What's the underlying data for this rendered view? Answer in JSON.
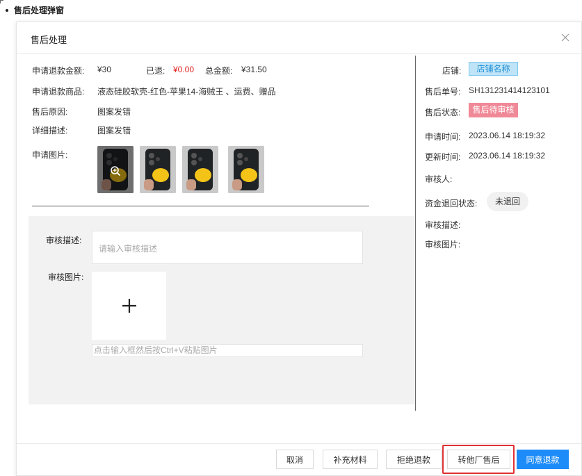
{
  "page": {
    "heading": "售后处理弹窗"
  },
  "dialog": {
    "title": "售后处理",
    "refund_amount_label": "申请退款金额:",
    "refund_amount": "¥30",
    "refunded_label": "已退:",
    "refunded_value": "¥0.00",
    "total_label": "总金额:",
    "total_value": "¥31.50",
    "goods_label": "申请退款商品:",
    "goods_value": "液态硅胶软壳-红色-苹果14-海贼王 、运费、赠品",
    "reason_label": "售后原因:",
    "reason_value": "图案发错",
    "detail_label": "详细描述:",
    "detail_value": "图案发错",
    "images_label": "申请图片:",
    "review": {
      "desc_label": "审核描述:",
      "desc_placeholder": "请输入审核描述",
      "image_label": "审核图片:",
      "upload_plus": "+",
      "paste_placeholder": "点击输入框然后按Ctrl+V粘贴图片"
    },
    "side": {
      "store_label": "店铺:",
      "store_value": "店铺名称",
      "order_label": "售后单号:",
      "order_value": "SH131231414123101",
      "status_label": "售后状态:",
      "status_value": "售后待审核",
      "apply_time_label": "申请时间:",
      "apply_time_value": "2023.06.14 18:19:32",
      "update_time_label": "更新时间:",
      "update_time_value": "2023.06.14 18:19:32",
      "reviewer_label": "审核人:",
      "refund_status_label": "资金退回状态:",
      "refund_status_value": "未退回",
      "review_desc_label": "审核描述:",
      "review_images_label": "审核图片:"
    },
    "buttons": {
      "cancel": "取消",
      "supplement": "补充材料",
      "reject": "拒绝退款",
      "transfer": "转他厂售后",
      "approve": "同意退款"
    }
  }
}
